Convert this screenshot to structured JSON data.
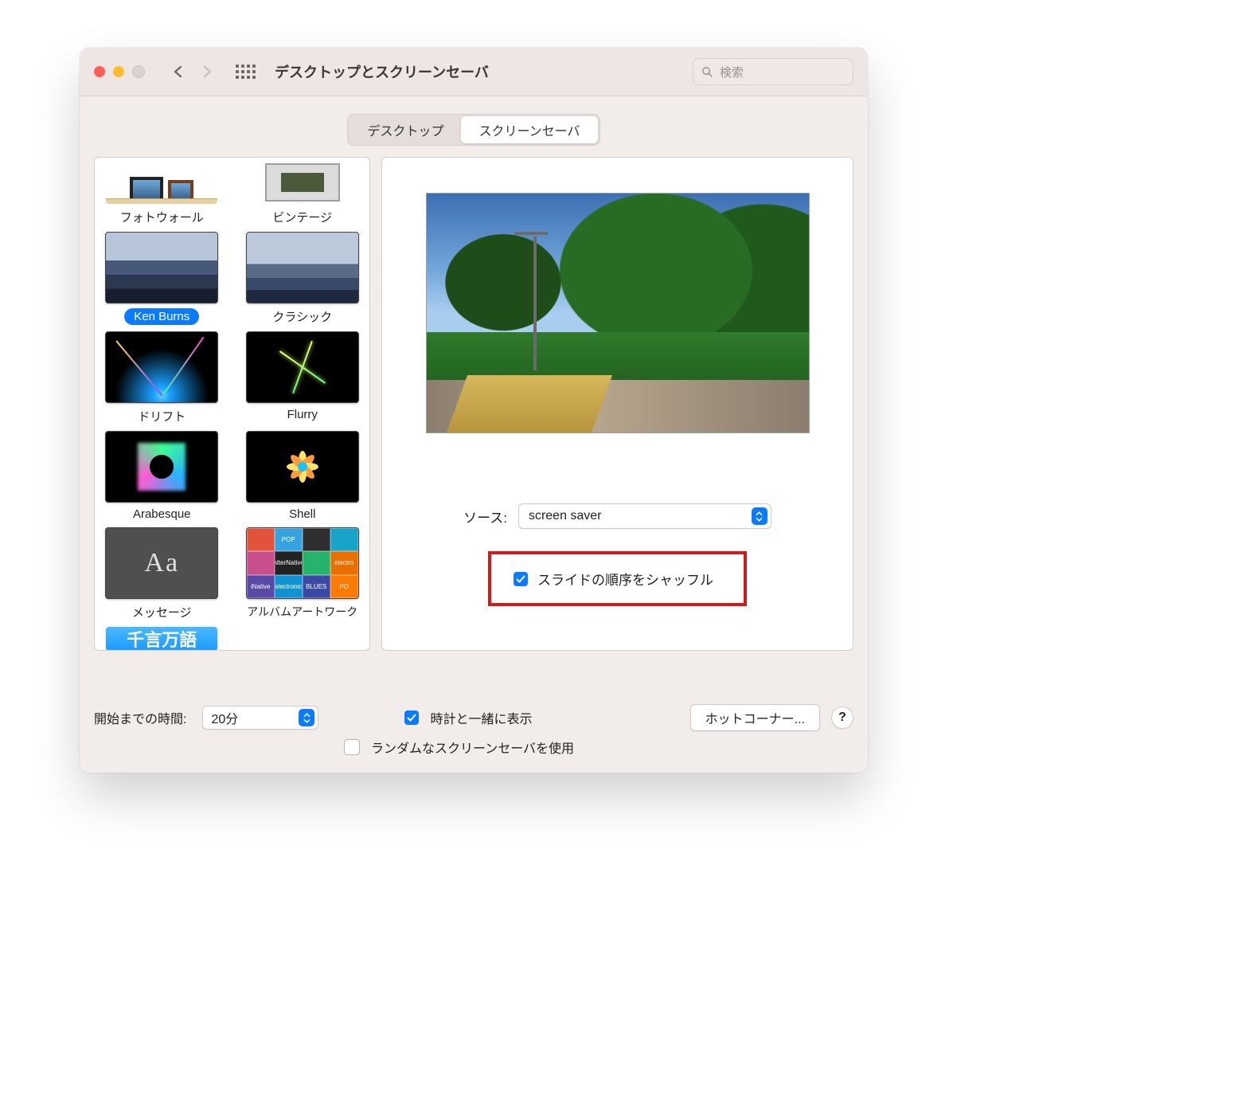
{
  "window": {
    "title": "デスクトップとスクリーンセーバ"
  },
  "search": {
    "placeholder": "検索"
  },
  "tabs": {
    "desktop": "デスクトップ",
    "screensaver": "スクリーンセーバ"
  },
  "savers": [
    {
      "key": "photowall",
      "label": "フォトウォール"
    },
    {
      "key": "vintage",
      "label": "ビンテージ"
    },
    {
      "key": "kenburns",
      "label": "Ken Burns"
    },
    {
      "key": "classic",
      "label": "クラシック"
    },
    {
      "key": "drift",
      "label": "ドリフト"
    },
    {
      "key": "flurry",
      "label": "Flurry"
    },
    {
      "key": "arabesque",
      "label": "Arabesque"
    },
    {
      "key": "shell",
      "label": "Shell"
    },
    {
      "key": "message",
      "label": "メッセージ"
    },
    {
      "key": "album",
      "label": "アルバムアートワーク"
    },
    {
      "key": "word",
      "label": "千言万語"
    }
  ],
  "selected_saver": "kenburns",
  "source": {
    "label": "ソース:",
    "value": "screen saver"
  },
  "shuffle": {
    "label": "スライドの順序をシャッフル",
    "checked": true
  },
  "bottom": {
    "start_label": "開始までの時間:",
    "start_value": "20分",
    "show_clock_label": "時計と一緒に表示",
    "show_clock_checked": true,
    "random_label": "ランダムなスクリーンセーバを使用",
    "random_checked": false,
    "hot_corners": "ホットコーナー...",
    "help": "?"
  }
}
